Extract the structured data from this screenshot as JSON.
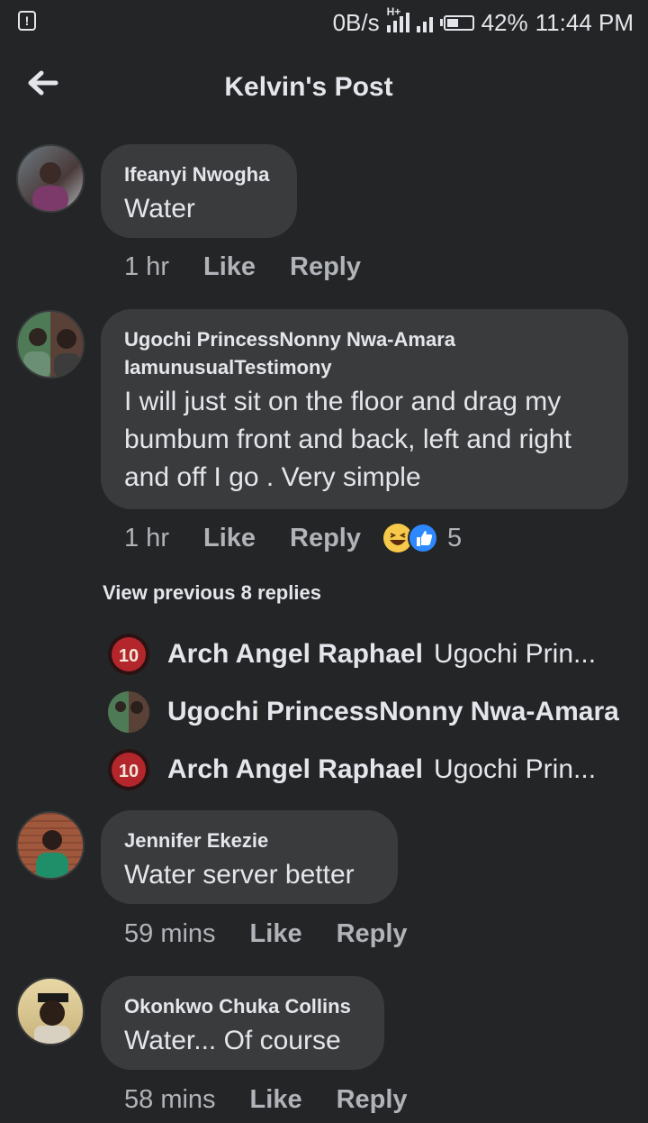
{
  "status_bar": {
    "alert_icon": "alert-icon",
    "speed": "0B/s",
    "network_type": "H+",
    "battery": "42%",
    "time": "11:44 PM"
  },
  "header": {
    "title": "Kelvin's Post",
    "back_icon": "arrow-left-icon"
  },
  "comments": [
    {
      "author": "Ifeanyi Nwogha",
      "text": "Water",
      "time": "1 hr",
      "like": "Like",
      "reply": "Reply"
    },
    {
      "author": "Ugochi PrincessNonny Nwa-Amara IamunusualTestimony",
      "text": "I will just sit on the floor and drag my bumbum front and back, left and right and off I go . Very simple",
      "time": "1 hr",
      "like": "Like",
      "reply": "Reply",
      "reactions": [
        "laugh-emoji",
        "like-emoji"
      ],
      "reaction_count": "5"
    },
    {
      "author": "Jennifer Ekezie",
      "text": "Water server better",
      "time": "59 mins",
      "like": "Like",
      "reply": "Reply"
    },
    {
      "author": "Okonkwo Chuka Collins",
      "text": "Water... Of course",
      "time": "58 mins",
      "like": "Like",
      "reply": "Reply"
    }
  ],
  "replies": {
    "view_previous": "View previous 8 replies",
    "items": [
      {
        "author": "Arch Angel Raphael",
        "preview": "Ugochi Prin..."
      },
      {
        "author": "Ugochi PrincessNonny Nwa-Amara",
        "preview": ""
      },
      {
        "author": "Arch Angel Raphael",
        "preview": "Ugochi Prin..."
      }
    ]
  }
}
